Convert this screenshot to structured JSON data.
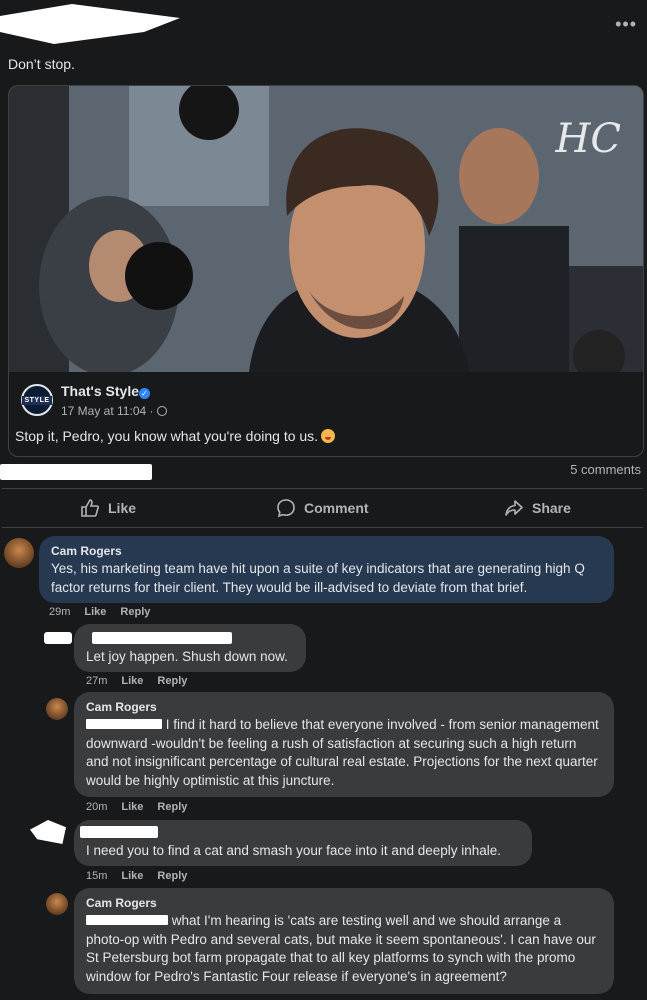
{
  "post": {
    "text": "Don’t stop.",
    "menu_icon": "more-dots-icon"
  },
  "shared": {
    "page_name": "That's Style",
    "avatar_text": "STYLE",
    "meta": "17 May at 11:04 ·",
    "text": "Stop it, Pedro, you know what you're doing to us.",
    "watermark": "HC"
  },
  "stats": {
    "comments": "5 comments"
  },
  "actions": {
    "like": "Like",
    "comment": "Comment",
    "share": "Share"
  },
  "comments": [
    {
      "author": "Cam Rogers",
      "text": "Yes, his marketing team have hit upon a suite of key indicators that are generating high Q factor returns for their client. They would be ill-advised to deviate from that brief.",
      "time": "29m",
      "like": "Like",
      "reply": "Reply"
    },
    {
      "author": "",
      "text": "Let joy happen. Shush down now.",
      "time": "27m",
      "like": "Like",
      "reply": "Reply"
    },
    {
      "author": "Cam Rogers",
      "text": " I find it hard to believe that everyone involved - from senior management downward -wouldn't be feeling a rush of satisfaction at securing such a high return and not insignificant percentage of cultural real estate. Projections for the next quarter would be highly optimistic at this juncture.",
      "time": "20m",
      "like": "Like",
      "reply": "Reply"
    },
    {
      "author": "",
      "text": "I need you to find a cat and smash your face into it and deeply inhale.",
      "time": "15m",
      "like": "Like",
      "reply": "Reply"
    },
    {
      "author": "Cam Rogers",
      "text": " what I'm hearing is 'cats are testing well and we should arrange a photo-op with Pedro and several cats, but make it seem spontaneous'. I can have our St Petersburg bot farm propagate that to all key platforms to synch with the promo window for Pedro's Fantastic Four release if everyone's in agreement?"
    }
  ]
}
